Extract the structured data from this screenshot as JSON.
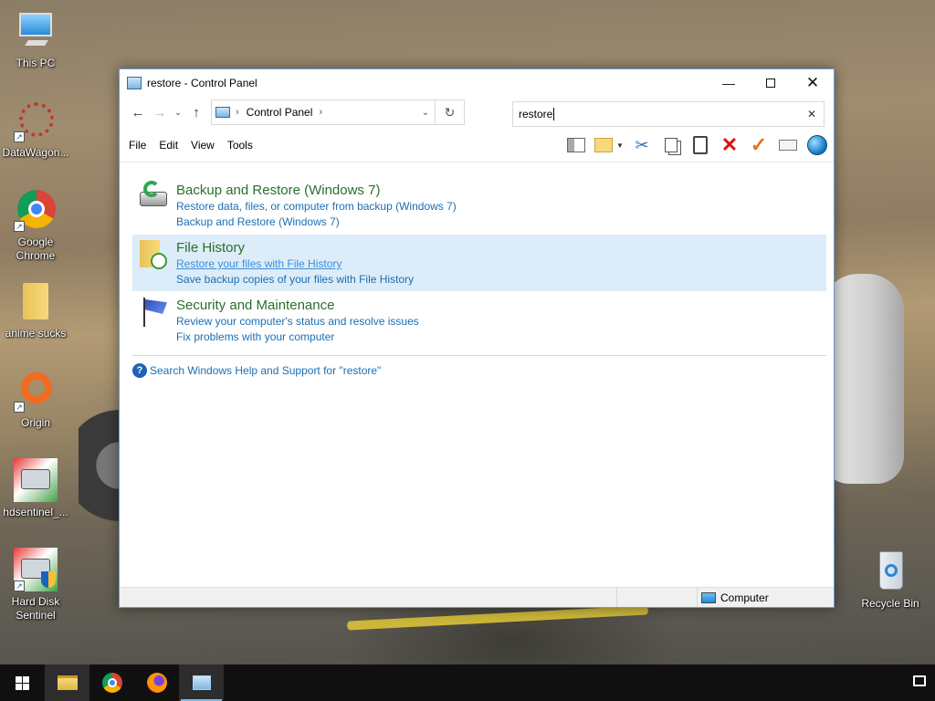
{
  "desktop": {
    "icons": [
      {
        "label": "This PC",
        "icon": "computer-icon"
      },
      {
        "label": "DataWagon...",
        "icon": "datawagon-icon"
      },
      {
        "label": "Google Chrome",
        "icon": "chrome-icon"
      },
      {
        "label": "anime sucks",
        "icon": "folder-icon"
      },
      {
        "label": "Origin",
        "icon": "origin-icon"
      },
      {
        "label": "hdsentinel_...",
        "icon": "hard-disk-icon"
      },
      {
        "label": "Hard Disk Sentinel",
        "icon": "hard-disk-sentinel-icon"
      },
      {
        "label": "Recycle Bin",
        "icon": "recycle-bin-icon"
      }
    ]
  },
  "window": {
    "title": "restore - Control Panel",
    "address": {
      "crumb": "Control Panel"
    },
    "search": {
      "value": "restore"
    },
    "menu": [
      "File",
      "Edit",
      "View",
      "Tools"
    ],
    "results": [
      {
        "title": "Backup and Restore (Windows 7)",
        "links": [
          "Restore data, files, or computer from backup (Windows 7)",
          "Backup and Restore (Windows 7)"
        ]
      },
      {
        "title": "File History",
        "links": [
          "Restore your files with File History",
          "Save backup copies of your files with File History"
        ]
      },
      {
        "title": "Security and Maintenance",
        "links": [
          "Review your computer's status and resolve issues",
          "Fix problems with your computer"
        ]
      }
    ],
    "help_link": "Search Windows Help and Support for \"restore\"",
    "status": {
      "location": "Computer"
    }
  },
  "colors": {
    "accent": "#1a6fb4",
    "result_title": "#2c6e2c",
    "selection": "#dcecf8"
  }
}
